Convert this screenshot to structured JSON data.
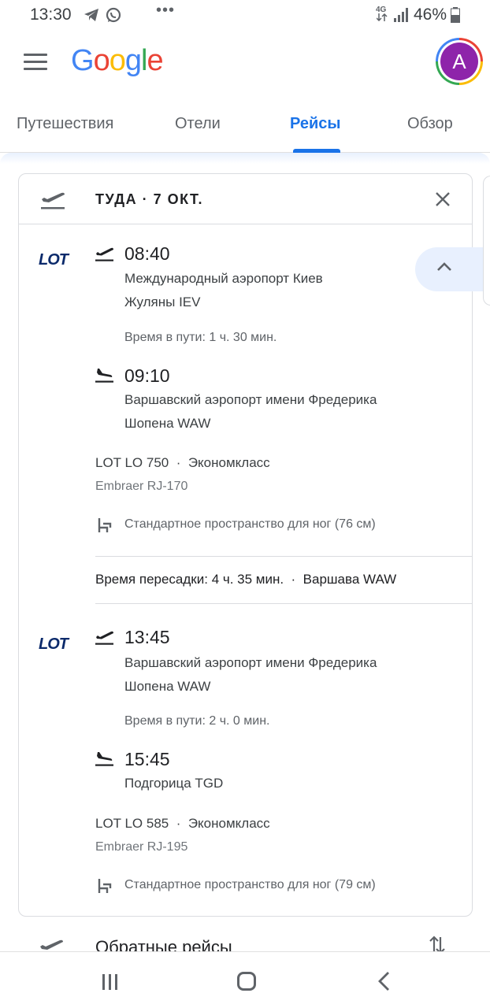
{
  "status_bar": {
    "time": "13:30",
    "network": "4G",
    "battery": "46%"
  },
  "app": {
    "logo": "Google",
    "avatar_letter": "A",
    "avatar_color": "#8e24aa"
  },
  "tabs": [
    {
      "label": "Путешествия",
      "active": false
    },
    {
      "label": "Отели",
      "active": false
    },
    {
      "label": "Рейсы",
      "active": true
    },
    {
      "label": "Обзор",
      "active": false
    }
  ],
  "card": {
    "title": "ТУДА  ·  7 ОКТ.",
    "segments": [
      {
        "airline_logo": "LOT",
        "dep_time": "08:40",
        "dep_airport_line1": "Международный аэропорт Киев",
        "dep_airport_line2": "Жуляны IEV",
        "duration": "Время в пути: 1 ч. 30 мин.",
        "arr_time": "09:10",
        "arr_airport_line1": "Варшавский аэропорт имени Фредерика",
        "arr_airport_line2": "Шопена WAW",
        "flight": "LOT LO 750",
        "class": "Экономкласс",
        "aircraft": "Embraer RJ-170",
        "legroom": "Стандартное пространство для ног (76 см)"
      },
      {
        "airline_logo": "LOT",
        "dep_time": "13:45",
        "dep_airport_line1": "Варшавский аэропорт имени Фредерика",
        "dep_airport_line2": "Шопена WAW",
        "duration": "Время в пути: 2 ч. 0 мин.",
        "arr_time": "15:45",
        "arr_airport_line1": "Подгорица TGD",
        "arr_airport_line2": "",
        "flight": "LOT LO 585",
        "class": "Экономкласс",
        "aircraft": "Embraer RJ-195",
        "legroom": "Стандартное пространство для ног (79 см)"
      }
    ],
    "layover": {
      "duration": "Время пересадки: 4 ч. 35 мин.",
      "city": "Варшава WAW"
    }
  },
  "return_flights_label": "Обратные рейсы",
  "colors": {
    "accent": "#1a73e8",
    "lot_blue": "#0b2a6b"
  }
}
